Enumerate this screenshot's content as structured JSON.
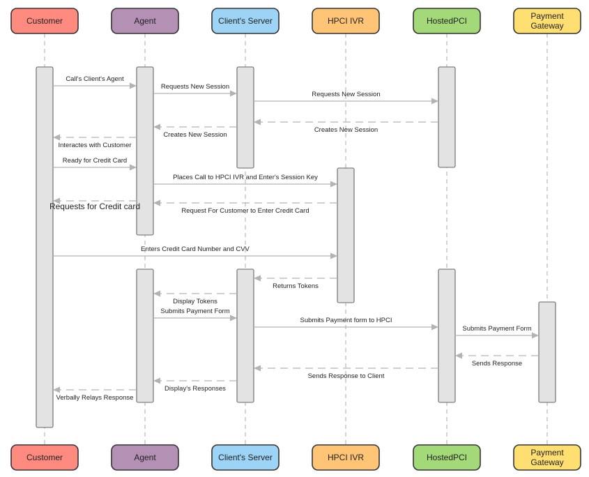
{
  "diagram": {
    "type": "sequence-diagram",
    "participants": [
      {
        "id": "customer",
        "label": "Customer",
        "color": "#ff8a80"
      },
      {
        "id": "agent",
        "label": "Agent",
        "color": "#b490b4"
      },
      {
        "id": "server",
        "label": "Client's Server",
        "color": "#9dd3f5"
      },
      {
        "id": "ivr",
        "label": "HPCI IVR",
        "color": "#ffc476"
      },
      {
        "id": "hpci",
        "label": "HostedPCI",
        "color": "#a3d978"
      },
      {
        "id": "gateway",
        "label": "Payment\nGateway",
        "color": "#ffdf71"
      }
    ],
    "activations": [
      {
        "participant": "customer",
        "start_step": 0,
        "end_step": 22
      },
      {
        "participant": "agent",
        "start_step": 0,
        "end_step": 10
      },
      {
        "participant": "server",
        "start_step": 0,
        "end_step": 6
      },
      {
        "participant": "hpci",
        "start_step": 0,
        "end_step": 6
      },
      {
        "participant": "ivr",
        "start_step": 6,
        "end_step": 14
      },
      {
        "participant": "agent",
        "start_step": 12,
        "end_step": 20
      },
      {
        "participant": "server",
        "start_step": 12,
        "end_step": 20
      },
      {
        "participant": "hpci",
        "start_step": 12,
        "end_step": 20
      },
      {
        "participant": "gateway",
        "start_step": 14,
        "end_step": 20
      }
    ],
    "messages": [
      {
        "order": 1,
        "from": "customer",
        "to": "agent",
        "label": "Call's Client's Agent",
        "style": "solid"
      },
      {
        "order": 2,
        "from": "agent",
        "to": "server",
        "label": "Requests New Session",
        "style": "solid"
      },
      {
        "order": 3,
        "from": "server",
        "to": "hpci",
        "label": "Requests New Session",
        "style": "solid"
      },
      {
        "order": 4,
        "from": "hpci",
        "to": "server",
        "label": "Creates New Session",
        "style": "dashed"
      },
      {
        "order": 5,
        "from": "server",
        "to": "agent",
        "label": "Creates New Session",
        "style": "dashed"
      },
      {
        "order": 6,
        "from": "agent",
        "to": "customer",
        "label": "Interactes with Customer",
        "style": "dashed"
      },
      {
        "order": 7,
        "from": "customer",
        "to": "agent",
        "label": "Ready for Credit Card",
        "style": "solid"
      },
      {
        "order": 8,
        "from": "agent",
        "to": "ivr",
        "label": "Places Call to HPCI IVR and Enter's Session Key",
        "style": "solid"
      },
      {
        "order": 9,
        "from": "ivr",
        "to": "agent",
        "label": "Request For Customer to Enter Credit Card",
        "style": "dashed"
      },
      {
        "order": 10,
        "from": "agent",
        "to": "customer",
        "label": "Requests for Credit card",
        "style": "dashed"
      },
      {
        "order": 11,
        "from": "customer",
        "to": "ivr",
        "label": "Enters Credit Card Number and CVV",
        "style": "solid"
      },
      {
        "order": 12,
        "from": "ivr",
        "to": "server",
        "label": "Returns Tokens",
        "style": "dashed"
      },
      {
        "order": 13,
        "from": "server",
        "to": "agent",
        "label": "Display Tokens",
        "style": "dashed"
      },
      {
        "order": 14,
        "from": "agent",
        "to": "server",
        "label": "Submits Payment Form",
        "style": "solid"
      },
      {
        "order": 15,
        "from": "server",
        "to": "hpci",
        "label": "Submits Payment form to HPCI",
        "style": "solid"
      },
      {
        "order": 16,
        "from": "hpci",
        "to": "gateway",
        "label": "Submits Payment Form",
        "style": "solid"
      },
      {
        "order": 17,
        "from": "gateway",
        "to": "hpci",
        "label": "Sends Response",
        "style": "dashed"
      },
      {
        "order": 18,
        "from": "hpci",
        "to": "server",
        "label": "Sends Response to Client",
        "style": "dashed"
      },
      {
        "order": 19,
        "from": "server",
        "to": "agent",
        "label": "Display's Responses",
        "style": "dashed"
      },
      {
        "order": 20,
        "from": "agent",
        "to": "customer",
        "label": "Verbally Relays Response",
        "style": "dashed"
      }
    ]
  }
}
